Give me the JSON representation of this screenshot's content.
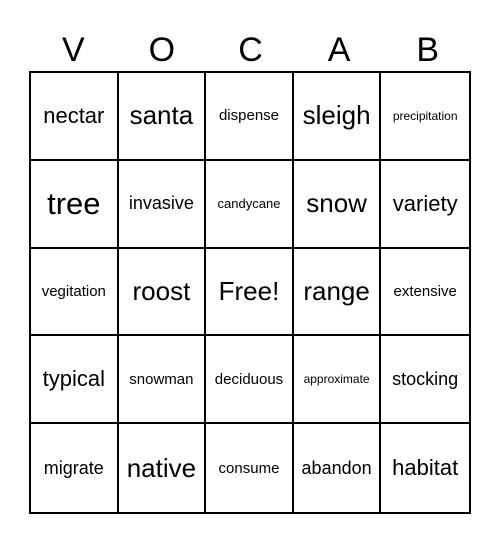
{
  "header": [
    "V",
    "O",
    "C",
    "A",
    "B"
  ],
  "cells": [
    {
      "text": "nectar",
      "size": "s3"
    },
    {
      "text": "santa",
      "size": "s2"
    },
    {
      "text": "dispense",
      "size": "s5"
    },
    {
      "text": "sleigh",
      "size": "s2"
    },
    {
      "text": "precipitation",
      "size": "s7"
    },
    {
      "text": "tree",
      "size": "s1"
    },
    {
      "text": "invasive",
      "size": "s4"
    },
    {
      "text": "candycane",
      "size": "s6"
    },
    {
      "text": "snow",
      "size": "s2"
    },
    {
      "text": "variety",
      "size": "s3"
    },
    {
      "text": "vegitation",
      "size": "s5"
    },
    {
      "text": "roost",
      "size": "s2"
    },
    {
      "text": "Free!",
      "size": "s2"
    },
    {
      "text": "range",
      "size": "s2"
    },
    {
      "text": "extensive",
      "size": "s5"
    },
    {
      "text": "typical",
      "size": "s3"
    },
    {
      "text": "snowman",
      "size": "s5"
    },
    {
      "text": "deciduous",
      "size": "s5"
    },
    {
      "text": "approximate",
      "size": "s7"
    },
    {
      "text": "stocking",
      "size": "s4"
    },
    {
      "text": "migrate",
      "size": "s4"
    },
    {
      "text": "native",
      "size": "s2"
    },
    {
      "text": "consume",
      "size": "s5"
    },
    {
      "text": "abandon",
      "size": "s4"
    },
    {
      "text": "habitat",
      "size": "s3"
    }
  ]
}
